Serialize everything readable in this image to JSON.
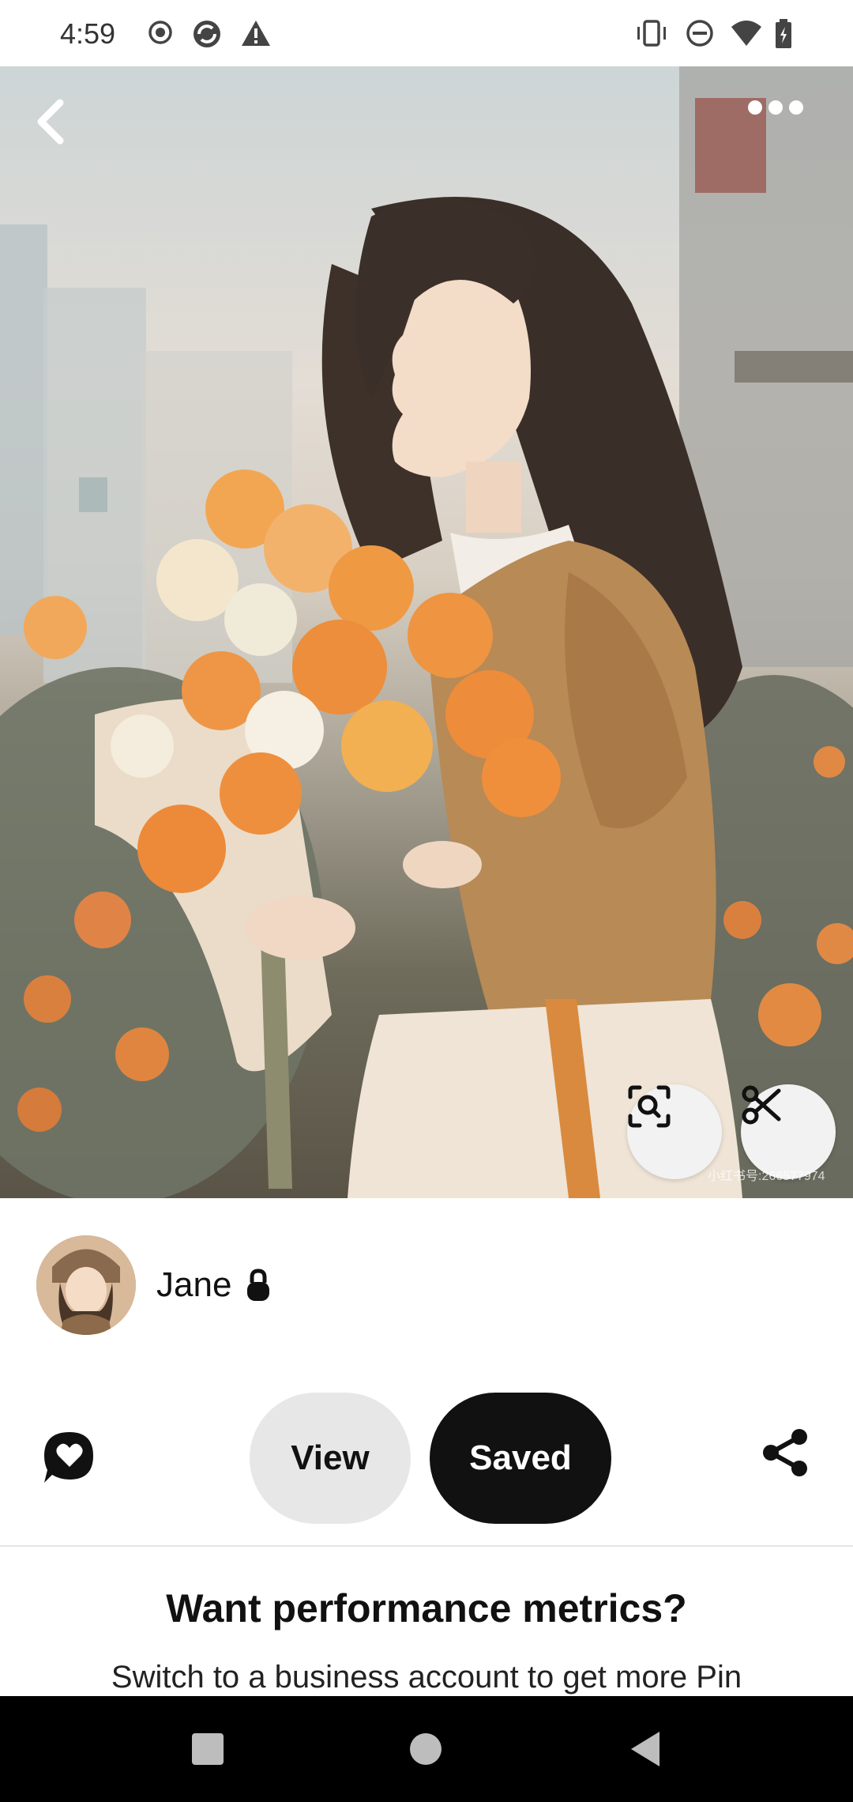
{
  "status_bar": {
    "time": "4:59",
    "icons_left": [
      "record-icon",
      "sync-icon",
      "warning-icon"
    ],
    "icons_right": [
      "vibrate-icon",
      "do-not-disturb-icon",
      "wifi-icon",
      "battery-icon"
    ]
  },
  "pin": {
    "watermark": "小红书号:266577974",
    "top_left_icon": "back-icon",
    "top_right_icon": "more-icon",
    "lens_icon": "visual-search-icon",
    "cut_icon": "scissors-icon"
  },
  "creator": {
    "name": "Jane",
    "lock_icon": "lock-icon"
  },
  "actions": {
    "comment_icon": "comment-heart-icon",
    "view_label": "View",
    "saved_label": "Saved",
    "share_icon": "share-icon"
  },
  "metrics": {
    "title": "Want performance metrics?",
    "text": "Switch to a business account to get more Pin"
  },
  "nav": {
    "icons": [
      "recents-icon",
      "home-icon",
      "back-nav-icon"
    ]
  },
  "colors": {
    "accent_dark": "#111111",
    "pill_light": "#e7e7e7",
    "flower_orange": "#e8893a"
  }
}
